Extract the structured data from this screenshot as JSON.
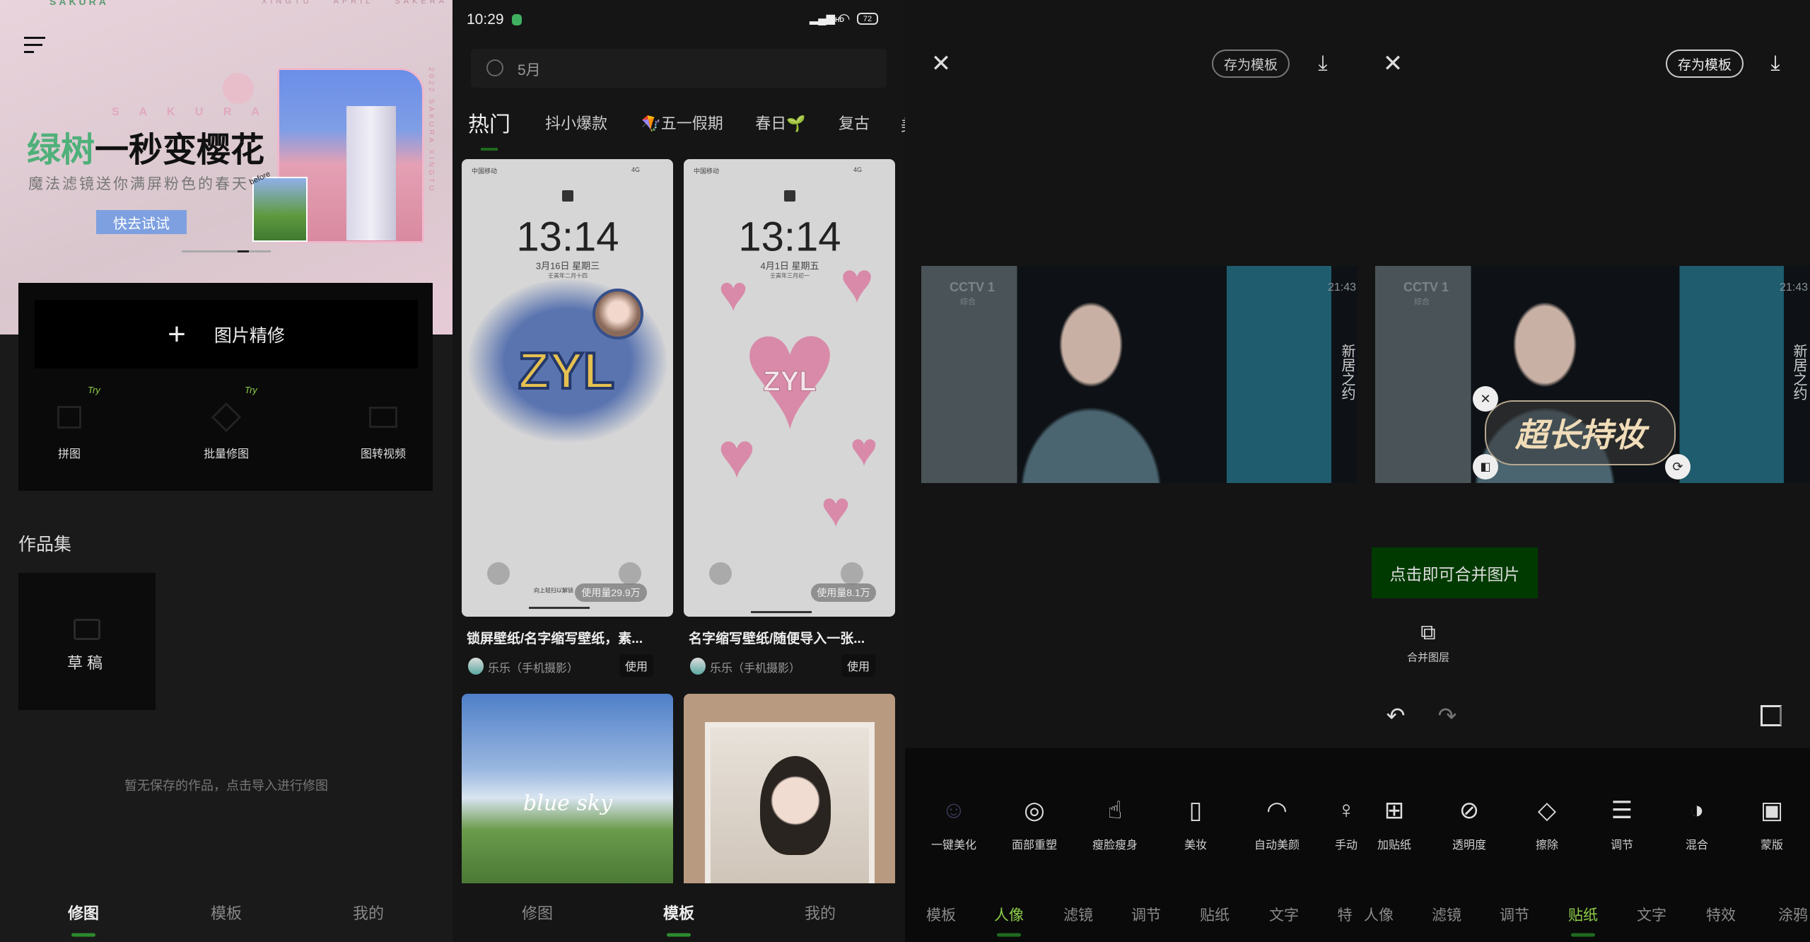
{
  "colors": {
    "accent_green": "#2d8a2d",
    "tab_active_green": "#8dcf4a",
    "merge_button_bg": "#003a00",
    "banner_pink": "#efd6e0"
  },
  "panel_home": {
    "banner": {
      "brand_top": "SAKURA",
      "top_words": [
        "XINGTU",
        "APRIL",
        "SAKERA"
      ],
      "sakura_caption": "S A K U R A",
      "headline_green": "绿树",
      "headline_black": "一秒变樱花",
      "subtitle": "魔法滤镜送你满屏粉色的春天",
      "cta": "快去试试",
      "before_label": "before",
      "side_text": "2022 SAKURA XINGTU"
    },
    "menu_icon": "hamburger-menu-icon",
    "main_button": {
      "icon": "plus-icon",
      "label": "图片精修"
    },
    "tools": [
      {
        "label": "拼图",
        "badge": "Try",
        "icon": "collage-icon"
      },
      {
        "label": "批量修图",
        "badge": "Try",
        "icon": "batch-edit-icon"
      },
      {
        "label": "图转视频",
        "badge": "",
        "icon": "video-icon"
      }
    ],
    "section_title": "作品集",
    "draft": {
      "icon": "inbox-icon",
      "label": "草稿"
    },
    "empty_text": "暂无保存的作品，点击导入进行修图",
    "nav": [
      {
        "label": "修图",
        "active": true
      },
      {
        "label": "模板",
        "active": false
      },
      {
        "label": "我的",
        "active": false
      }
    ]
  },
  "panel_templates": {
    "status": {
      "time": "10:29",
      "battery": "72",
      "signal": "HD"
    },
    "search": {
      "value": "5月",
      "icon": "search-icon"
    },
    "tabs": [
      {
        "label": "热门",
        "active": true
      },
      {
        "label": "抖小爆款"
      },
      {
        "label": "五一假期",
        "emoji": "🪁"
      },
      {
        "label": "春日",
        "emoji": "🌱"
      },
      {
        "label": "复古"
      },
      {
        "label": "美"
      }
    ],
    "cards": [
      {
        "carrier": "中国移动",
        "net": "4G",
        "time": "13:14",
        "date": "3月16日 星期三",
        "lunar": "壬寅年二月十四",
        "art": "ZYL",
        "swipe": "向上轻扫以解锁",
        "usage": "使用量29.9万",
        "title": "锁屏壁纸/名字缩写壁纸，素...",
        "author": "乐乐（手机摄影）",
        "use": "使用"
      },
      {
        "carrier": "中国移动",
        "net": "4G",
        "time": "13:14",
        "date": "4月1日 星期五",
        "lunar": "壬寅年三月初一",
        "art": "ZYL",
        "usage": "使用量8.1万",
        "title": "名字缩写壁纸/随便导入一张...",
        "author": "乐乐（手机摄影）",
        "use": "使用"
      }
    ],
    "cards_row2": [
      {
        "art": "blue sky"
      },
      {
        "art": ""
      }
    ],
    "nav": [
      {
        "label": "修图",
        "active": false
      },
      {
        "label": "模板",
        "active": true
      },
      {
        "label": "我的",
        "active": false
      }
    ]
  },
  "panel_editor": {
    "left": {
      "close_icon": "close-icon",
      "save_template": "存为模板",
      "download_icon": "download-icon"
    },
    "right": {
      "close_icon": "close-icon",
      "save_template": "存为模板",
      "download_icon": "download-icon"
    },
    "image": {
      "channel": "CCTV 1",
      "channel_sub": "综合",
      "clock": "21:43",
      "vertical_title": "新居之约"
    },
    "sticker": {
      "text": "超长持妆"
    },
    "merge_button": "点击即可合并图片",
    "merge_layer": "合并图层",
    "tools": [
      {
        "label": "一键美化",
        "icon": "auto-beautify-icon"
      },
      {
        "label": "面部重塑",
        "icon": "face-reshape-icon"
      },
      {
        "label": "瘦脸瘦身",
        "icon": "slim-touch-icon"
      },
      {
        "label": "美妆",
        "icon": "makeup-icon"
      },
      {
        "label": "自动美颜",
        "icon": "auto-beauty-icon"
      },
      {
        "label": "手动",
        "icon": "manual-icon"
      },
      {
        "label": "加贴纸",
        "icon": "add-sticker-icon"
      },
      {
        "label": "透明度",
        "icon": "opacity-icon"
      },
      {
        "label": "擦除",
        "icon": "eraser-icon"
      },
      {
        "label": "调节",
        "icon": "adjust-sliders-icon"
      },
      {
        "label": "混合",
        "icon": "blend-icon"
      },
      {
        "label": "蒙版",
        "icon": "mask-icon"
      }
    ],
    "tabs_left": [
      {
        "label": "模板"
      },
      {
        "label": "人像",
        "active": true
      },
      {
        "label": "滤镜"
      },
      {
        "label": "调节"
      },
      {
        "label": "贴纸"
      },
      {
        "label": "文字"
      },
      {
        "label": "特"
      }
    ],
    "tabs_right": [
      {
        "label": "人像"
      },
      {
        "label": "滤镜"
      },
      {
        "label": "调节"
      },
      {
        "label": "贴纸",
        "active": true
      },
      {
        "label": "文字"
      },
      {
        "label": "特效"
      },
      {
        "label": "涂鸦"
      }
    ]
  }
}
